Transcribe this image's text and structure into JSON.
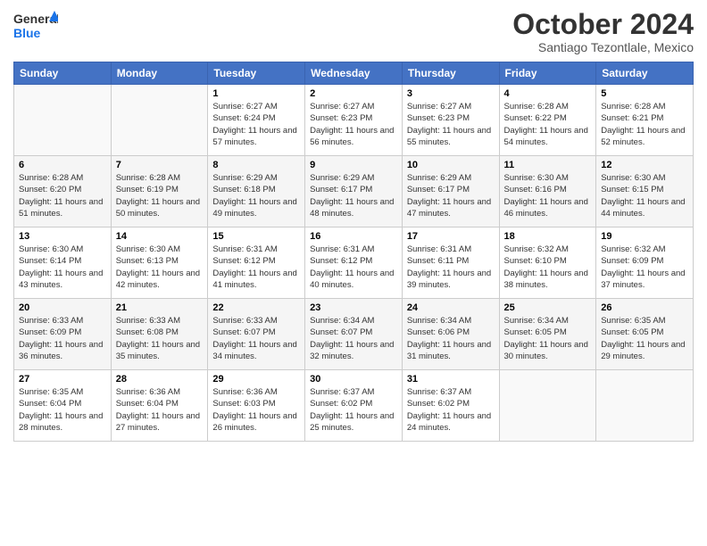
{
  "header": {
    "logo_general": "General",
    "logo_blue": "Blue",
    "month_title": "October 2024",
    "subtitle": "Santiago Tezontlale, Mexico"
  },
  "days_of_week": [
    "Sunday",
    "Monday",
    "Tuesday",
    "Wednesday",
    "Thursday",
    "Friday",
    "Saturday"
  ],
  "weeks": [
    [
      {
        "day": "",
        "info": ""
      },
      {
        "day": "",
        "info": ""
      },
      {
        "day": "1",
        "info": "Sunrise: 6:27 AM\nSunset: 6:24 PM\nDaylight: 11 hours and 57 minutes."
      },
      {
        "day": "2",
        "info": "Sunrise: 6:27 AM\nSunset: 6:23 PM\nDaylight: 11 hours and 56 minutes."
      },
      {
        "day": "3",
        "info": "Sunrise: 6:27 AM\nSunset: 6:23 PM\nDaylight: 11 hours and 55 minutes."
      },
      {
        "day": "4",
        "info": "Sunrise: 6:28 AM\nSunset: 6:22 PM\nDaylight: 11 hours and 54 minutes."
      },
      {
        "day": "5",
        "info": "Sunrise: 6:28 AM\nSunset: 6:21 PM\nDaylight: 11 hours and 52 minutes."
      }
    ],
    [
      {
        "day": "6",
        "info": "Sunrise: 6:28 AM\nSunset: 6:20 PM\nDaylight: 11 hours and 51 minutes."
      },
      {
        "day": "7",
        "info": "Sunrise: 6:28 AM\nSunset: 6:19 PM\nDaylight: 11 hours and 50 minutes."
      },
      {
        "day": "8",
        "info": "Sunrise: 6:29 AM\nSunset: 6:18 PM\nDaylight: 11 hours and 49 minutes."
      },
      {
        "day": "9",
        "info": "Sunrise: 6:29 AM\nSunset: 6:17 PM\nDaylight: 11 hours and 48 minutes."
      },
      {
        "day": "10",
        "info": "Sunrise: 6:29 AM\nSunset: 6:17 PM\nDaylight: 11 hours and 47 minutes."
      },
      {
        "day": "11",
        "info": "Sunrise: 6:30 AM\nSunset: 6:16 PM\nDaylight: 11 hours and 46 minutes."
      },
      {
        "day": "12",
        "info": "Sunrise: 6:30 AM\nSunset: 6:15 PM\nDaylight: 11 hours and 44 minutes."
      }
    ],
    [
      {
        "day": "13",
        "info": "Sunrise: 6:30 AM\nSunset: 6:14 PM\nDaylight: 11 hours and 43 minutes."
      },
      {
        "day": "14",
        "info": "Sunrise: 6:30 AM\nSunset: 6:13 PM\nDaylight: 11 hours and 42 minutes."
      },
      {
        "day": "15",
        "info": "Sunrise: 6:31 AM\nSunset: 6:12 PM\nDaylight: 11 hours and 41 minutes."
      },
      {
        "day": "16",
        "info": "Sunrise: 6:31 AM\nSunset: 6:12 PM\nDaylight: 11 hours and 40 minutes."
      },
      {
        "day": "17",
        "info": "Sunrise: 6:31 AM\nSunset: 6:11 PM\nDaylight: 11 hours and 39 minutes."
      },
      {
        "day": "18",
        "info": "Sunrise: 6:32 AM\nSunset: 6:10 PM\nDaylight: 11 hours and 38 minutes."
      },
      {
        "day": "19",
        "info": "Sunrise: 6:32 AM\nSunset: 6:09 PM\nDaylight: 11 hours and 37 minutes."
      }
    ],
    [
      {
        "day": "20",
        "info": "Sunrise: 6:33 AM\nSunset: 6:09 PM\nDaylight: 11 hours and 36 minutes."
      },
      {
        "day": "21",
        "info": "Sunrise: 6:33 AM\nSunset: 6:08 PM\nDaylight: 11 hours and 35 minutes."
      },
      {
        "day": "22",
        "info": "Sunrise: 6:33 AM\nSunset: 6:07 PM\nDaylight: 11 hours and 34 minutes."
      },
      {
        "day": "23",
        "info": "Sunrise: 6:34 AM\nSunset: 6:07 PM\nDaylight: 11 hours and 32 minutes."
      },
      {
        "day": "24",
        "info": "Sunrise: 6:34 AM\nSunset: 6:06 PM\nDaylight: 11 hours and 31 minutes."
      },
      {
        "day": "25",
        "info": "Sunrise: 6:34 AM\nSunset: 6:05 PM\nDaylight: 11 hours and 30 minutes."
      },
      {
        "day": "26",
        "info": "Sunrise: 6:35 AM\nSunset: 6:05 PM\nDaylight: 11 hours and 29 minutes."
      }
    ],
    [
      {
        "day": "27",
        "info": "Sunrise: 6:35 AM\nSunset: 6:04 PM\nDaylight: 11 hours and 28 minutes."
      },
      {
        "day": "28",
        "info": "Sunrise: 6:36 AM\nSunset: 6:04 PM\nDaylight: 11 hours and 27 minutes."
      },
      {
        "day": "29",
        "info": "Sunrise: 6:36 AM\nSunset: 6:03 PM\nDaylight: 11 hours and 26 minutes."
      },
      {
        "day": "30",
        "info": "Sunrise: 6:37 AM\nSunset: 6:02 PM\nDaylight: 11 hours and 25 minutes."
      },
      {
        "day": "31",
        "info": "Sunrise: 6:37 AM\nSunset: 6:02 PM\nDaylight: 11 hours and 24 minutes."
      },
      {
        "day": "",
        "info": ""
      },
      {
        "day": "",
        "info": ""
      }
    ]
  ]
}
